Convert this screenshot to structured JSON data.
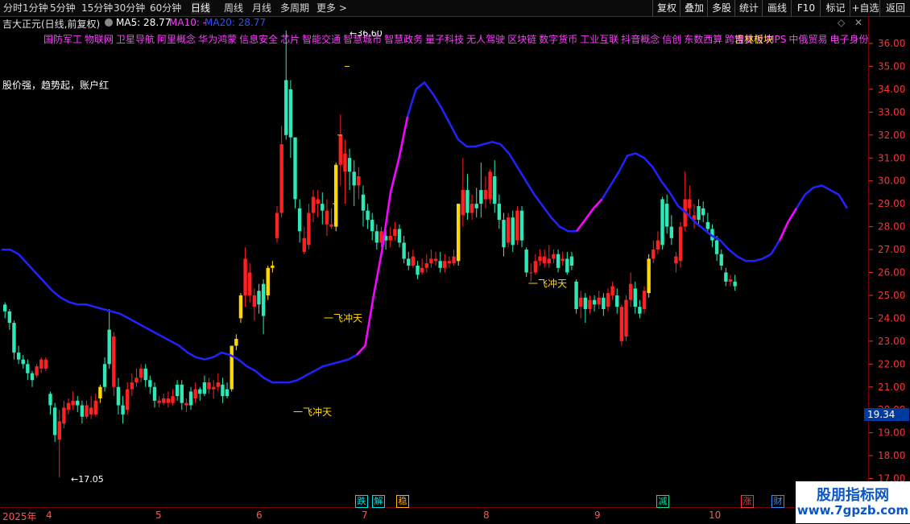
{
  "toolbar": {
    "left": [
      "分时",
      "1分钟",
      "5分钟",
      "15分钟",
      "30分钟",
      "60分钟",
      "日线",
      "周线",
      "月线",
      "多周期",
      "更多 >"
    ],
    "active": "日线",
    "right": [
      "复权",
      "叠加",
      "多股",
      "统计",
      "画线",
      "F10",
      "标记",
      "+自选",
      "返回"
    ]
  },
  "title": {
    "stock": "吉大正元(日线,前复权)",
    "ma5": "MA5: 28.77",
    "ma10": "MA10: -",
    "ma20": "MA20: 28.77",
    "window_buttons": [
      "◇",
      "✕"
    ]
  },
  "concepts": [
    "国防军工",
    "物联网",
    "卫星导航",
    "阿里概念",
    "华为鸿蒙",
    "信息安全",
    "芯片",
    "智能交通",
    "智慧城市",
    "智慧政务",
    "量子科技",
    "无人驾驶",
    "区块链",
    "数字货币",
    "工业互联",
    "抖音概念",
    "信创",
    "东数西算",
    "跨境支付",
    "MPS",
    "中俄贸易",
    "电子身份"
  ],
  "concept_highlight": "吉林板块",
  "indicator_text": "股价强，趋势起，账户红",
  "annotations": {
    "high_label": "←36.60",
    "low_label": "←17.05",
    "signals": [
      "一飞冲天",
      "一飞冲天",
      "一飞冲天"
    ]
  },
  "price_axis": [
    "36.00",
    "35.00",
    "34.00",
    "33.00",
    "32.00",
    "31.00",
    "30.00",
    "29.00",
    "28.00",
    "27.00",
    "26.00",
    "25.00",
    "24.00",
    "23.00",
    "22.00",
    "21.00",
    "20.00",
    "19.00",
    "18.00",
    "17.00"
  ],
  "current_price": "19.34",
  "time_axis": {
    "year": "2025年",
    "months": [
      "4",
      "5",
      "6",
      "7",
      "8",
      "9",
      "10"
    ]
  },
  "signal_badges": [
    {
      "text": "跌",
      "color": "#00e0e0"
    },
    {
      "text": "解",
      "color": "#00e0e0"
    },
    {
      "text": "稳",
      "color": "#ffb000"
    },
    {
      "text": "减",
      "color": "#00e0a0"
    },
    {
      "text": "涨",
      "color": "#ff3030"
    },
    {
      "text": "财",
      "color": "#3c8cff"
    }
  ],
  "watermark": {
    "title": "股朋指标网",
    "url": "www.7gpzb.com"
  },
  "colors": {
    "up": "#ff2020",
    "down": "#2ee8b8",
    "signal": "#ffd700",
    "ma": "#2222ff",
    "ma_hot": "#ff00ff",
    "axis": "#ff3232"
  },
  "chart_data": {
    "type": "candlestick",
    "price_range": [
      17.0,
      36.6
    ],
    "high": 36.6,
    "low": 17.05,
    "candles": [
      [
        24.6,
        24.3,
        24.7,
        24.0,
        "d"
      ],
      [
        24.3,
        23.8,
        24.4,
        23.5,
        "d"
      ],
      [
        23.8,
        22.5,
        23.9,
        22.2,
        "d"
      ],
      [
        22.5,
        22.2,
        22.8,
        22.0,
        "d"
      ],
      [
        22.2,
        22.0,
        22.4,
        21.8,
        "d"
      ],
      [
        22.0,
        21.6,
        22.2,
        21.3,
        "d"
      ],
      [
        21.6,
        21.3,
        21.7,
        21.0,
        "d"
      ],
      [
        21.5,
        21.9,
        22.0,
        21.4,
        "u"
      ],
      [
        21.8,
        22.2,
        22.3,
        21.6,
        "u"
      ],
      [
        22.2,
        21.8,
        22.3,
        21.7,
        "u"
      ],
      [
        20.7,
        20.2,
        20.8,
        19.8,
        "d"
      ],
      [
        20.1,
        18.9,
        20.3,
        18.6,
        "d"
      ],
      [
        18.7,
        19.5,
        20.0,
        17.05,
        "u"
      ],
      [
        19.4,
        20.1,
        20.4,
        19.2,
        "u"
      ],
      [
        20.0,
        20.3,
        20.5,
        19.8,
        "u"
      ],
      [
        20.2,
        20.4,
        20.8,
        20.0,
        "u"
      ],
      [
        20.4,
        20.2,
        20.6,
        19.9,
        "d"
      ],
      [
        20.2,
        19.7,
        20.4,
        19.4,
        "d"
      ],
      [
        19.7,
        20.2,
        20.4,
        19.6,
        "u"
      ],
      [
        20.1,
        19.8,
        20.6,
        19.6,
        "u"
      ],
      [
        19.8,
        20.4,
        20.7,
        19.7,
        "u"
      ],
      [
        20.5,
        21.0,
        21.1,
        20.3,
        "s"
      ],
      [
        21.0,
        22.0,
        22.3,
        20.8,
        "d"
      ],
      [
        22.0,
        23.5,
        24.4,
        21.8,
        "d"
      ],
      [
        23.2,
        21.0,
        23.4,
        20.6,
        "u"
      ],
      [
        21.0,
        20.2,
        21.4,
        19.8,
        "d"
      ],
      [
        20.2,
        19.8,
        20.6,
        19.4,
        "d"
      ],
      [
        20.0,
        20.9,
        21.2,
        19.8,
        "u"
      ],
      [
        20.9,
        21.2,
        21.6,
        20.6,
        "u"
      ],
      [
        21.2,
        21.4,
        21.8,
        21.0,
        "u"
      ],
      [
        21.4,
        21.8,
        22.0,
        21.2,
        "u"
      ],
      [
        21.8,
        21.3,
        22.0,
        21.0,
        "d"
      ],
      [
        21.3,
        21.0,
        21.5,
        20.7,
        "d"
      ],
      [
        21.0,
        20.4,
        21.2,
        20.1,
        "d"
      ],
      [
        20.4,
        20.3,
        20.6,
        20.1,
        "u"
      ],
      [
        20.3,
        20.5,
        20.7,
        20.2,
        "u"
      ],
      [
        20.5,
        20.3,
        20.8,
        20.1,
        "u"
      ],
      [
        20.3,
        20.6,
        20.9,
        20.2,
        "u"
      ],
      [
        20.6,
        21.1,
        21.3,
        20.4,
        "d"
      ],
      [
        21.1,
        20.3,
        21.3,
        20.0,
        "d"
      ],
      [
        20.3,
        20.2,
        20.5,
        19.9,
        "u"
      ],
      [
        20.2,
        20.8,
        21.0,
        20.0,
        "d"
      ],
      [
        20.5,
        20.9,
        21.2,
        20.3,
        "u"
      ],
      [
        20.9,
        20.7,
        21.0,
        20.4,
        "d"
      ],
      [
        20.7,
        21.2,
        21.5,
        20.6,
        "d"
      ],
      [
        21.2,
        20.9,
        21.4,
        20.7,
        "u"
      ],
      [
        20.9,
        21.0,
        21.3,
        20.5,
        "u"
      ],
      [
        21.0,
        21.2,
        21.6,
        20.8,
        "u"
      ],
      [
        21.1,
        20.6,
        21.4,
        20.3,
        "d"
      ],
      [
        20.6,
        20.9,
        21.2,
        20.5,
        "d"
      ],
      [
        20.9,
        22.8,
        22.8,
        20.8,
        "s"
      ],
      [
        22.8,
        23.1,
        23.3,
        22.6,
        "s"
      ],
      [
        24.0,
        25.0,
        25.1,
        23.8,
        "s"
      ],
      [
        25.0,
        26.6,
        27.1,
        24.5,
        "u"
      ],
      [
        26.0,
        25.0,
        26.4,
        24.7,
        "u"
      ],
      [
        25.0,
        24.5,
        25.3,
        23.9,
        "u"
      ],
      [
        24.6,
        25.2,
        25.5,
        24.2,
        "d"
      ],
      [
        25.5,
        24.1,
        25.7,
        23.3,
        "d"
      ],
      [
        25.0,
        26.2,
        26.3,
        24.8,
        "s"
      ],
      [
        26.2,
        26.3,
        26.5,
        26.0,
        "s"
      ],
      [
        27.5,
        28.6,
        28.9,
        27.3,
        "u"
      ],
      [
        28.6,
        31.6,
        32.4,
        28.4,
        "u"
      ],
      [
        32.0,
        34.4,
        36.6,
        31.8,
        "d"
      ],
      [
        34.0,
        31.9,
        34.4,
        31.0,
        "d"
      ],
      [
        31.9,
        29.2,
        31.9,
        28.8,
        "d"
      ],
      [
        28.8,
        27.8,
        29.2,
        27.3,
        "d"
      ],
      [
        27.5,
        26.9,
        28.0,
        26.8,
        "u"
      ],
      [
        27.2,
        28.6,
        29.0,
        27.0,
        "u"
      ],
      [
        28.6,
        29.3,
        29.6,
        28.2,
        "u"
      ],
      [
        29.2,
        29.0,
        29.6,
        28.4,
        "u"
      ],
      [
        29.0,
        28.7,
        29.5,
        28.1,
        "d"
      ],
      [
        28.7,
        28.1,
        29.2,
        27.6,
        "u"
      ],
      [
        28.1,
        28.0,
        28.8,
        27.9,
        "u"
      ],
      [
        28.0,
        30.7,
        30.8,
        27.8,
        "s"
      ],
      [
        30.7,
        32.0,
        32.9,
        29.8,
        "u"
      ],
      [
        31.2,
        30.4,
        31.8,
        29.0,
        "u"
      ],
      [
        30.4,
        31.0,
        31.4,
        29.6,
        "d"
      ],
      [
        30.4,
        29.8,
        30.9,
        28.9,
        "d"
      ],
      [
        29.8,
        30.2,
        30.6,
        29.2,
        "u"
      ],
      [
        29.4,
        28.7,
        29.8,
        28.0,
        "d"
      ],
      [
        28.7,
        28.3,
        29.0,
        27.9,
        "d"
      ],
      [
        28.3,
        27.8,
        28.6,
        27.4,
        "d"
      ],
      [
        27.8,
        27.3,
        28.1,
        27.0,
        "d"
      ],
      [
        27.3,
        27.8,
        28.0,
        27.1,
        "u"
      ],
      [
        27.6,
        27.4,
        27.9,
        27.0,
        "d"
      ],
      [
        27.4,
        27.6,
        28.0,
        27.1,
        "u"
      ],
      [
        27.6,
        27.9,
        28.2,
        27.4,
        "u"
      ],
      [
        27.9,
        27.3,
        28.1,
        27.1,
        "d"
      ],
      [
        27.3,
        26.6,
        27.6,
        26.4,
        "d"
      ],
      [
        26.6,
        26.3,
        26.9,
        26.1,
        "d"
      ],
      [
        26.3,
        26.7,
        27.0,
        26.2,
        "u"
      ],
      [
        26.3,
        25.9,
        26.5,
        25.7,
        "d"
      ],
      [
        26.0,
        26.2,
        26.6,
        25.9,
        "u"
      ],
      [
        26.2,
        26.4,
        26.8,
        26.0,
        "u"
      ],
      [
        26.4,
        26.6,
        27.0,
        26.2,
        "u"
      ],
      [
        26.6,
        26.5,
        26.9,
        26.3,
        "u"
      ],
      [
        26.5,
        26.2,
        26.9,
        26.0,
        "d"
      ],
      [
        26.2,
        26.5,
        26.8,
        26.0,
        "u"
      ],
      [
        26.5,
        26.4,
        26.7,
        26.2,
        "u"
      ],
      [
        26.4,
        26.7,
        27.0,
        26.3,
        "u"
      ],
      [
        26.5,
        29.0,
        29.0,
        26.3,
        "s"
      ],
      [
        28.5,
        29.6,
        31.0,
        28.0,
        "u"
      ],
      [
        29.6,
        28.6,
        30.3,
        28.3,
        "d"
      ],
      [
        28.6,
        29.0,
        29.4,
        28.3,
        "u"
      ],
      [
        29.0,
        28.8,
        29.7,
        28.4,
        "d"
      ],
      [
        29.0,
        29.6,
        30.8,
        28.4,
        "d"
      ],
      [
        29.6,
        29.2,
        30.2,
        28.8,
        "u"
      ],
      [
        29.2,
        30.4,
        30.5,
        29.0,
        "u"
      ],
      [
        30.2,
        29.0,
        30.9,
        28.6,
        "d"
      ],
      [
        29.0,
        28.3,
        29.4,
        27.9,
        "d"
      ],
      [
        28.3,
        27.1,
        28.6,
        26.7,
        "d"
      ],
      [
        27.3,
        28.4,
        28.6,
        27.1,
        "u"
      ],
      [
        28.4,
        27.2,
        28.7,
        26.9,
        "d"
      ],
      [
        27.4,
        28.7,
        28.9,
        27.2,
        "u"
      ],
      [
        28.7,
        27.4,
        28.9,
        27.1,
        "d"
      ],
      [
        27.0,
        26.0,
        27.1,
        25.8,
        "d"
      ],
      [
        26.0,
        26.0,
        26.4,
        25.6,
        "u"
      ],
      [
        26.0,
        26.5,
        26.8,
        25.9,
        "u"
      ],
      [
        26.5,
        26.7,
        27.0,
        26.3,
        "u"
      ],
      [
        26.7,
        26.4,
        27.0,
        26.2,
        "u"
      ],
      [
        26.4,
        26.6,
        27.2,
        26.2,
        "u"
      ],
      [
        26.6,
        26.8,
        27.0,
        26.4,
        "u"
      ],
      [
        26.8,
        26.2,
        27.0,
        26.0,
        "d"
      ],
      [
        26.5,
        26.6,
        26.9,
        26.3,
        "u"
      ],
      [
        26.6,
        26.0,
        26.9,
        25.9,
        "d"
      ],
      [
        26.3,
        26.7,
        26.9,
        26.1,
        "d"
      ],
      [
        25.6,
        24.4,
        25.7,
        24.2,
        "d"
      ],
      [
        24.5,
        24.9,
        25.2,
        24.0,
        "u"
      ],
      [
        24.9,
        24.4,
        25.1,
        23.8,
        "d"
      ],
      [
        24.4,
        24.8,
        25.0,
        24.2,
        "u"
      ],
      [
        24.8,
        24.6,
        25.0,
        24.3,
        "d"
      ],
      [
        24.6,
        24.9,
        25.2,
        24.4,
        "u"
      ],
      [
        24.9,
        24.4,
        25.1,
        24.1,
        "d"
      ],
      [
        24.5,
        25.1,
        25.3,
        24.3,
        "u"
      ],
      [
        25.0,
        25.4,
        25.6,
        24.8,
        "u"
      ],
      [
        25.0,
        24.5,
        25.3,
        24.2,
        "d"
      ],
      [
        24.5,
        23.0,
        24.6,
        22.8,
        "u"
      ],
      [
        23.2,
        24.8,
        25.0,
        23.0,
        "u"
      ],
      [
        24.8,
        25.5,
        26.0,
        24.5,
        "u"
      ],
      [
        25.3,
        24.5,
        25.6,
        24.2,
        "d"
      ],
      [
        24.5,
        24.2,
        24.8,
        24.0,
        "d"
      ],
      [
        24.4,
        25.2,
        25.4,
        24.2,
        "u"
      ],
      [
        25.1,
        26.6,
        26.8,
        24.9,
        "s"
      ],
      [
        26.6,
        27.0,
        27.4,
        26.4,
        "u"
      ],
      [
        27.0,
        27.4,
        27.8,
        26.8,
        "u"
      ],
      [
        27.2,
        29.2,
        29.3,
        27.0,
        "d"
      ],
      [
        29.0,
        28.0,
        29.4,
        27.7,
        "d"
      ],
      [
        28.0,
        27.5,
        28.5,
        27.2,
        "d"
      ],
      [
        26.4,
        26.7,
        26.9,
        26.0,
        "u"
      ],
      [
        26.5,
        28.0,
        28.2,
        26.2,
        "u"
      ],
      [
        28.0,
        29.2,
        30.4,
        27.8,
        "u"
      ],
      [
        29.2,
        28.8,
        29.8,
        28.4,
        "u"
      ],
      [
        28.5,
        28.3,
        29.0,
        27.9,
        "u"
      ],
      [
        28.3,
        28.9,
        29.2,
        28.0,
        "d"
      ],
      [
        28.8,
        28.5,
        29.1,
        28.2,
        "d"
      ],
      [
        28.2,
        27.9,
        28.6,
        27.7,
        "d"
      ],
      [
        27.9,
        27.4,
        28.1,
        27.1,
        "d"
      ],
      [
        27.4,
        26.8,
        27.6,
        26.5,
        "d"
      ],
      [
        26.8,
        26.3,
        27.0,
        26.1,
        "d"
      ],
      [
        26.0,
        25.6,
        26.2,
        25.4,
        "d"
      ],
      [
        25.6,
        25.7,
        25.9,
        25.4,
        "u"
      ],
      [
        25.6,
        25.4,
        25.9,
        25.2,
        "d"
      ]
    ],
    "signal_labels": [
      "一飞冲天",
      "一飞冲天",
      "一飞冲天"
    ],
    "ma_line": [
      27.0,
      27.0,
      26.8,
      26.4,
      26.0,
      25.6,
      25.2,
      24.9,
      24.7,
      24.6,
      24.6,
      24.5,
      24.4,
      24.3,
      24.2,
      24.0,
      23.8,
      23.6,
      23.4,
      23.2,
      23.0,
      22.8,
      22.5,
      22.3,
      22.2,
      22.3,
      22.5,
      22.4,
      22.2,
      21.9,
      21.7,
      21.4,
      21.2,
      21.2,
      21.2,
      21.3,
      21.5,
      21.7,
      21.9,
      22.0,
      22.1,
      22.2,
      22.4,
      22.8,
      25.0,
      27.0,
      29.5,
      31.0,
      32.8,
      34.0,
      34.3,
      33.8,
      33.2,
      32.5,
      31.8,
      31.5,
      31.5,
      31.6,
      31.7,
      31.6,
      31.2,
      30.6,
      30.0,
      29.4,
      28.9,
      28.4,
      28.0,
      27.8,
      27.8,
      28.3,
      28.8,
      29.2,
      29.8,
      30.4,
      31.1,
      31.2,
      31.0,
      30.6,
      30.0,
      29.5,
      28.9,
      28.6,
      28.2,
      27.9,
      27.6,
      27.4,
      27.0,
      26.7,
      26.5,
      26.5,
      26.6,
      26.8,
      27.4,
      28.2,
      28.8,
      29.4,
      29.7,
      29.8,
      29.6,
      29.4,
      28.8
    ]
  }
}
